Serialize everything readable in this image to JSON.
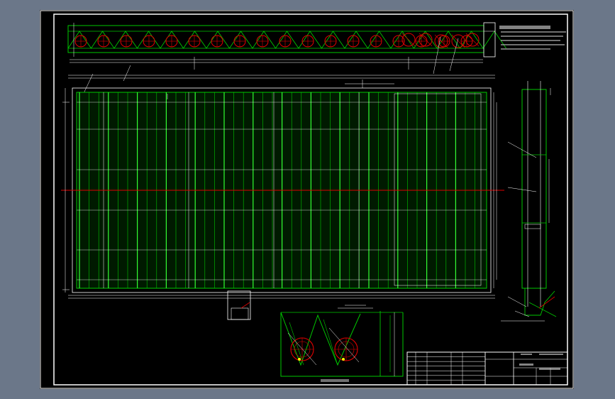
{
  "colors": {
    "viewport_bg": "#6b7789",
    "paper": "#000000",
    "frame": "#ffffff",
    "green": "#00c800",
    "bright_green": "#33ff33",
    "red": "#e00000",
    "white": "#ffffff",
    "yellow": "#ffff00",
    "cyan": "#00e0e0"
  },
  "title_block": {
    "rows": 7,
    "cols": 9
  },
  "icons": {
    "roller": "circle-with-cross-icon",
    "truss": "triangle-truss-icon"
  }
}
